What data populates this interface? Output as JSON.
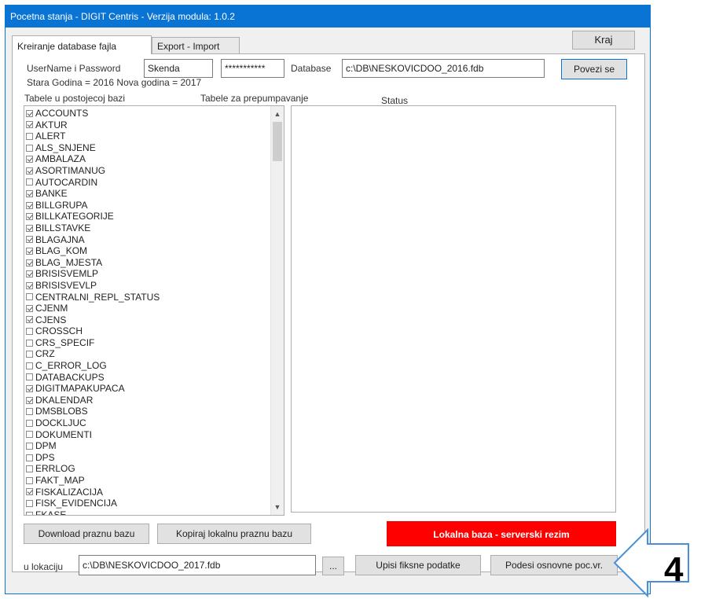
{
  "window": {
    "title": "Pocetna stanja - DIGIT Centris - Verzija modula: 1.0.2"
  },
  "tabs": [
    {
      "label": "Kreiranje database fajla"
    },
    {
      "label": "Export - Import"
    }
  ],
  "toolbar": {
    "close_label": "Kraj"
  },
  "login": {
    "label": "UserName i Password",
    "username": "Skenda",
    "password": "***********",
    "db_label": "Database",
    "db_path": "c:\\DB\\NESKOVICDOO_2016.fdb",
    "connect_label": "Povezi se"
  },
  "years_text": "Stara Godina = 2016 Nova godina = 2017",
  "headers": {
    "tables": "Tabele u postojecoj bazi",
    "transfer": "Tabele za prepumpavanje",
    "status": "Status"
  },
  "tables": [
    {
      "name": "ACCOUNTS",
      "checked": true
    },
    {
      "name": "AKTUR",
      "checked": true
    },
    {
      "name": "ALERT",
      "checked": false
    },
    {
      "name": "ALS_SNJENE",
      "checked": false
    },
    {
      "name": "AMBALAZA",
      "checked": true
    },
    {
      "name": "ASORTIMANUG",
      "checked": true
    },
    {
      "name": "AUTOCARDIN",
      "checked": false
    },
    {
      "name": "BANKE",
      "checked": true
    },
    {
      "name": "BILLGRUPA",
      "checked": true
    },
    {
      "name": "BILLKATEGORIJE",
      "checked": true
    },
    {
      "name": "BILLSTAVKE",
      "checked": true
    },
    {
      "name": "BLAGAJNA",
      "checked": true
    },
    {
      "name": "BLAG_KOM",
      "checked": true
    },
    {
      "name": "BLAG_MJESTA",
      "checked": true
    },
    {
      "name": "BRISISVEMLP",
      "checked": true
    },
    {
      "name": "BRISISVEVLP",
      "checked": true
    },
    {
      "name": "CENTRALNI_REPL_STATUS",
      "checked": false
    },
    {
      "name": "CJENM",
      "checked": true
    },
    {
      "name": "CJENS",
      "checked": true
    },
    {
      "name": "CROSSCH",
      "checked": false
    },
    {
      "name": "CRS_SPECIF",
      "checked": false
    },
    {
      "name": "CRZ",
      "checked": false
    },
    {
      "name": "C_ERROR_LOG",
      "checked": false
    },
    {
      "name": "DATABACKUPS",
      "checked": false
    },
    {
      "name": "DIGITMAPAKUPACA",
      "checked": true
    },
    {
      "name": "DKALENDAR",
      "checked": true
    },
    {
      "name": "DMSBLOBS",
      "checked": false
    },
    {
      "name": "DOCKLJUC",
      "checked": false
    },
    {
      "name": "DOKUMENTI",
      "checked": false
    },
    {
      "name": "DPM",
      "checked": false
    },
    {
      "name": "DPS",
      "checked": false
    },
    {
      "name": "ERRLOG",
      "checked": false
    },
    {
      "name": "FAKT_MAP",
      "checked": false
    },
    {
      "name": "FISKALIZACIJA",
      "checked": true
    },
    {
      "name": "FISK_EVIDENCIJA",
      "checked": false
    },
    {
      "name": "FKASE",
      "checked": false
    }
  ],
  "buttons": {
    "download": "Download praznu bazu",
    "copy_local": "Kopiraj lokalnu praznu bazu",
    "mode": "Lokalna baza - serverski rezim",
    "browse": "...",
    "write_fixed": "Upisi fiksne podatke",
    "setup_basic": "Podesi osnovne poc.vr."
  },
  "location": {
    "label": "u lokaciju",
    "path": "c:\\DB\\NESKOVICDOO_2017.fdb"
  },
  "annotation": {
    "number": "4"
  },
  "colors": {
    "titlebar": "#0a74d4",
    "mode_button": "#ff0000",
    "arrow": "#4a90d9"
  }
}
